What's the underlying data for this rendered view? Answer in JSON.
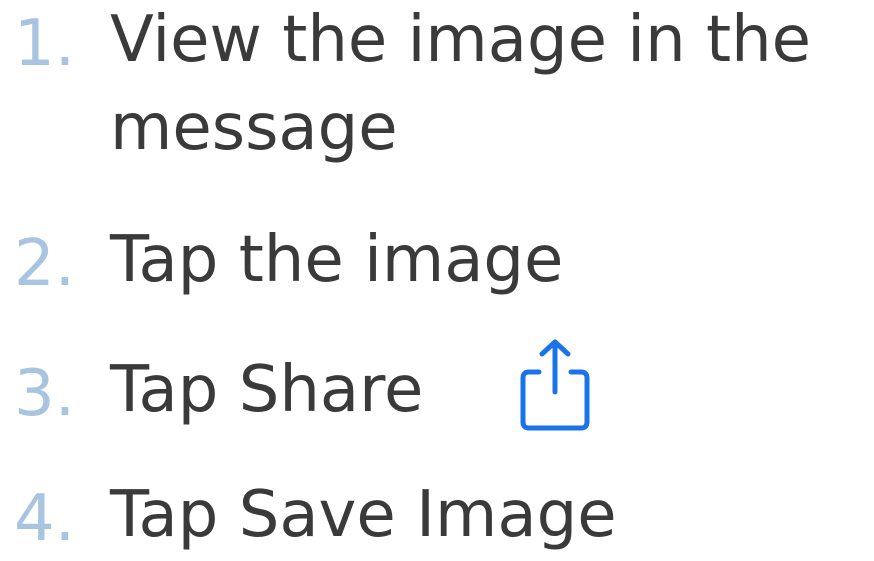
{
  "steps": [
    {
      "number": "1.",
      "text": "View the image in the message"
    },
    {
      "number": "2.",
      "text": "Tap the image"
    },
    {
      "number": "3.",
      "text": "Tap Share",
      "icon": "share-icon"
    },
    {
      "number": "4.",
      "text": "Tap Save Image"
    }
  ],
  "colors": {
    "number": "#a8c4e0",
    "text": "#3a3a3a",
    "icon": "#1a73e8"
  }
}
